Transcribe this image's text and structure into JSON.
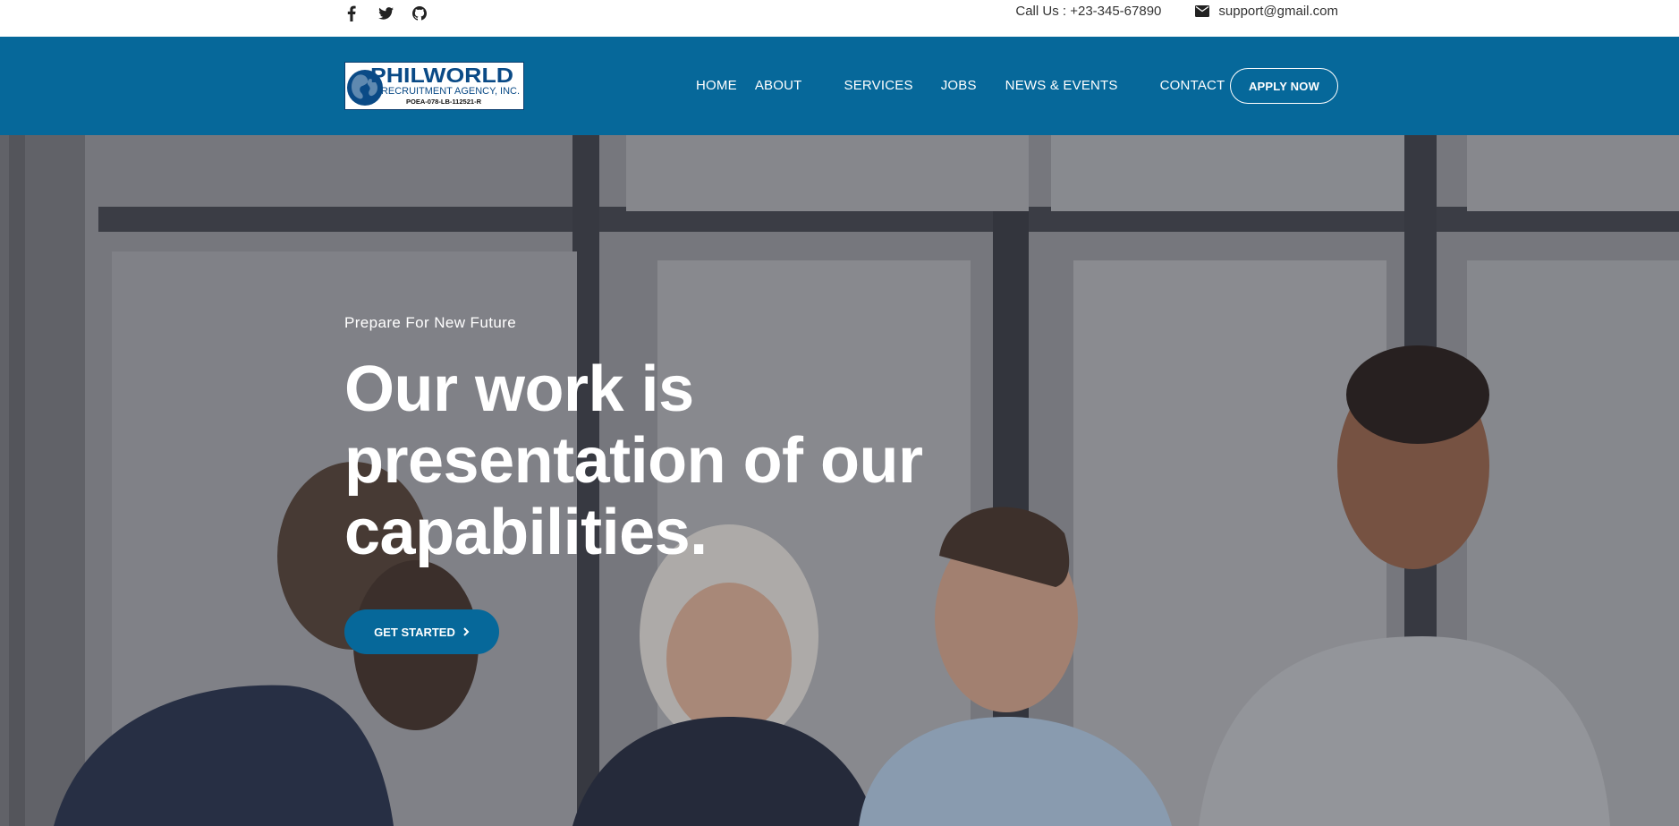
{
  "topbar": {
    "social_icons": [
      "facebook-icon",
      "twitter-icon",
      "github-icon"
    ],
    "phone_text": "Call Us : +23-345-67890",
    "email_icon": "envelope-icon",
    "email_text": "support@gmail.com"
  },
  "navbar": {
    "logo": {
      "name": "PHILWORLD",
      "subtitle": "RECRUITMENT AGENCY, INC.",
      "license": "POEA-078-LB-112521-R"
    },
    "menu": [
      "HOME",
      "ABOUT",
      "SERVICES",
      "JOBS",
      "NEWS & EVENTS",
      "CONTACT"
    ],
    "apply_label": "APPLY NOW"
  },
  "hero": {
    "eyebrow": "Prepare For New Future",
    "headline": [
      "Our work is",
      "presentation of our",
      "capabilities."
    ],
    "cta_label": "GET STARTED",
    "cta_icon": "chevron-right-icon"
  },
  "colors": {
    "brand_blue": "#06689a",
    "white": "#ffffff",
    "text_dark": "#222222"
  }
}
